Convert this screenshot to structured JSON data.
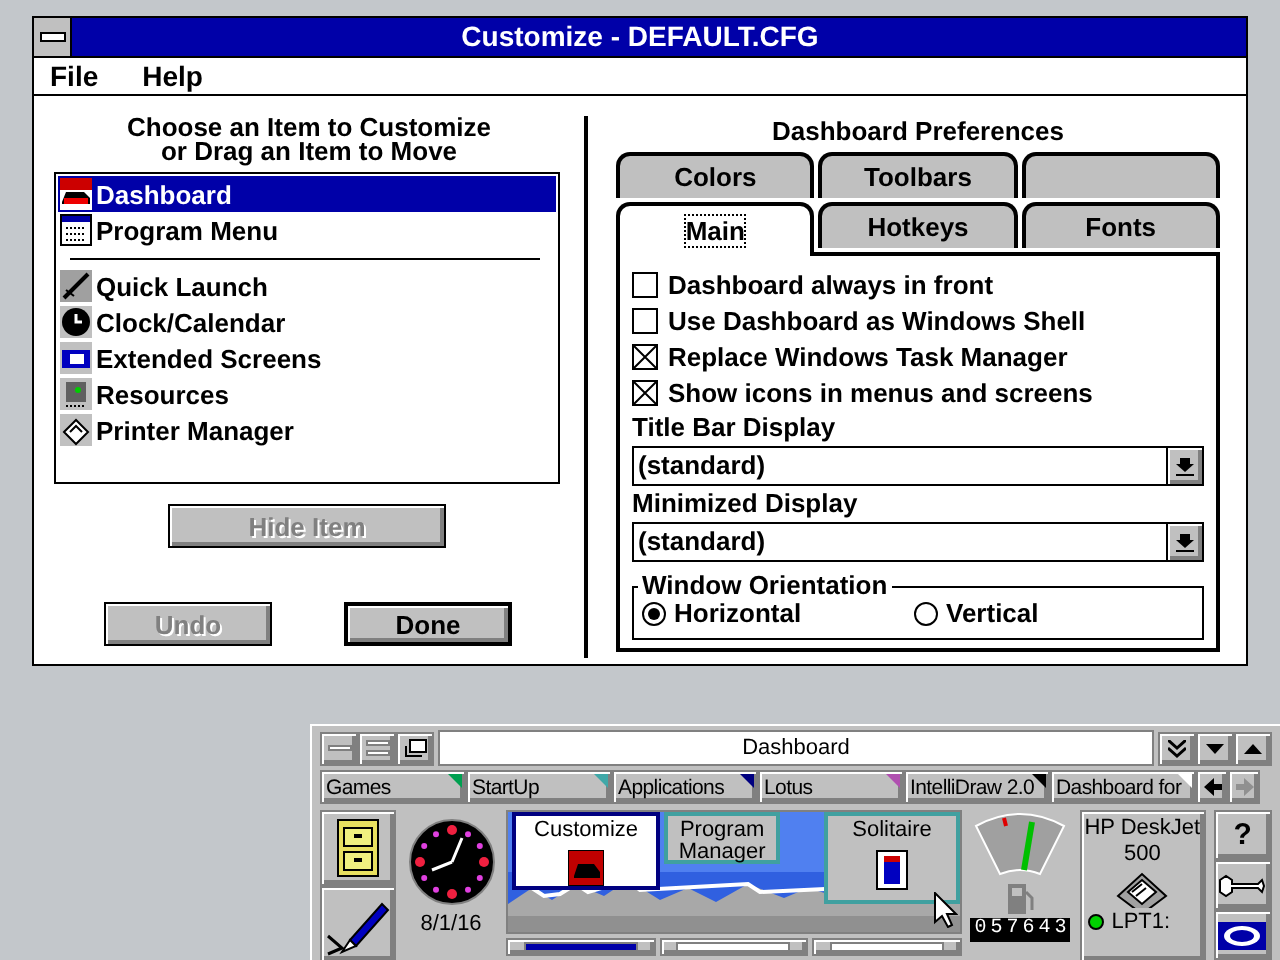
{
  "window": {
    "title": "Customize - DEFAULT.CFG"
  },
  "menu": [
    "File",
    "Help"
  ],
  "items_pane": {
    "heading": "Choose an Item to Customize\nor Drag an Item to Move",
    "items": [
      {
        "kind": "item",
        "label": "Dashboard",
        "selected": true
      },
      {
        "kind": "item",
        "label": "Program Menu",
        "selected": false
      },
      {
        "kind": "separator"
      },
      {
        "kind": "item",
        "label": "Quick Launch",
        "selected": false
      },
      {
        "kind": "item",
        "label": "Clock/Calendar",
        "selected": false
      },
      {
        "kind": "item",
        "label": "Extended Screens",
        "selected": false
      },
      {
        "kind": "item",
        "label": "Resources",
        "selected": false
      },
      {
        "kind": "item",
        "label": "Printer Manager",
        "selected": false
      }
    ],
    "hide_button": {
      "label": "Hide Item",
      "disabled": true
    },
    "undo_button": {
      "label": "Undo",
      "disabled": true
    },
    "done_button": {
      "label": "Done",
      "disabled": false
    }
  },
  "preferences": {
    "heading": "Dashboard Preferences",
    "tab_rows": [
      [
        {
          "label": "Colors",
          "selected": false
        },
        {
          "label": "Toolbars",
          "selected": false
        },
        {
          "selected": false
        }
      ],
      [
        {
          "label": "Main",
          "selected": true
        },
        {
          "label": "Hotkeys",
          "selected": false
        },
        {
          "label": "Fonts",
          "selected": false
        }
      ]
    ],
    "checkboxes": [
      {
        "label": "Dashboard always in front",
        "checked": false
      },
      {
        "label": "Use Dashboard as Windows Shell",
        "checked": false
      },
      {
        "label": "Replace Windows Task Manager",
        "checked": true
      },
      {
        "label": "Show icons in menus and screens",
        "checked": true
      }
    ],
    "title_bar_display": {
      "label": "Title Bar Display",
      "value": "(standard)"
    },
    "minimized_display": {
      "label": "Minimized Display",
      "value": "(standard)"
    },
    "orientation": {
      "label": "Window Orientation",
      "options": [
        {
          "label": "Horizontal",
          "selected": true
        },
        {
          "label": "Vertical",
          "selected": false
        }
      ]
    }
  },
  "dashboard": {
    "title": "Dashboard",
    "groups": [
      {
        "label": "Games",
        "color": "#00a050"
      },
      {
        "label": "StartUp",
        "color": "#40a8a8"
      },
      {
        "label": "Applications",
        "color": "#000080"
      },
      {
        "label": "Lotus",
        "color": "#b050b0"
      },
      {
        "label": "IntelliDraw 2.0",
        "color": "#000000"
      },
      {
        "label": "Dashboard for",
        "color": "#ffffff"
      }
    ],
    "date": "8/1/16",
    "windows": [
      {
        "label": "Customize",
        "active": true
      },
      {
        "label": "Program Manager",
        "active": false
      },
      {
        "label": "Solitaire",
        "active": false
      }
    ],
    "screens": [
      {
        "selected": true
      },
      {
        "selected": false
      },
      {
        "selected": false
      }
    ],
    "counter": "057643",
    "printer": {
      "name": "HP DeskJet 500",
      "port": "LPT1:",
      "online": true
    },
    "help": "?"
  }
}
